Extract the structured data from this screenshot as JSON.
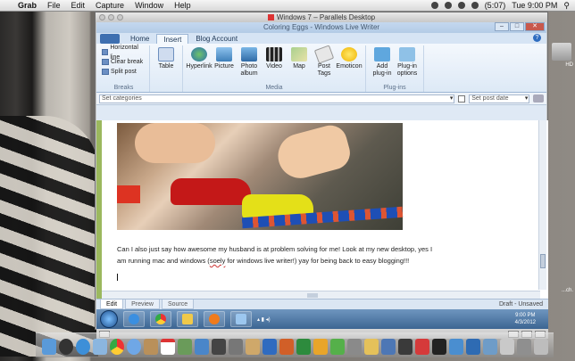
{
  "mac_menu": {
    "app": "Grab",
    "items": [
      "File",
      "Edit",
      "Capture",
      "Window",
      "Help"
    ],
    "battery": "(5:07)",
    "clock": "Tue 9:00 PM"
  },
  "parallels": {
    "title": "Windows 7 – Parallels Desktop"
  },
  "lw": {
    "title": "Coloring Eggs - Windows Live Writer",
    "tabs": [
      "Home",
      "Insert",
      "Blog Account"
    ],
    "breaks": {
      "items": [
        "Horizontal line",
        "Clear break",
        "Split post"
      ],
      "label": "Breaks"
    },
    "table": "Table",
    "media": {
      "items": [
        "Hyperlink",
        "Picture",
        "Photo album",
        "Video",
        "Map",
        "Post Tags",
        "Emoticon"
      ],
      "label": "Media"
    },
    "plugins": {
      "items": [
        "Add plug-in",
        "Plug-in options"
      ],
      "label": "Plug-ins"
    },
    "categories_placeholder": "Set categories",
    "post_date_placeholder": "Set post date",
    "body": {
      "text_before": "Can I also just say how awesome my husband is at problem solving for me! Look at my new desktop, yes I am running mac and windows (",
      "spell": "soely",
      "text_after": " for windows live writer!) yay for being back to easy blogging!!!"
    },
    "view_tabs": [
      "Edit",
      "Preview",
      "Source"
    ],
    "status": "Draft - Unsaved"
  },
  "taskbar": {
    "time": "9:00 PM",
    "date": "4/3/2012"
  },
  "side": {
    "hd": "HD",
    "label": "...ch."
  }
}
